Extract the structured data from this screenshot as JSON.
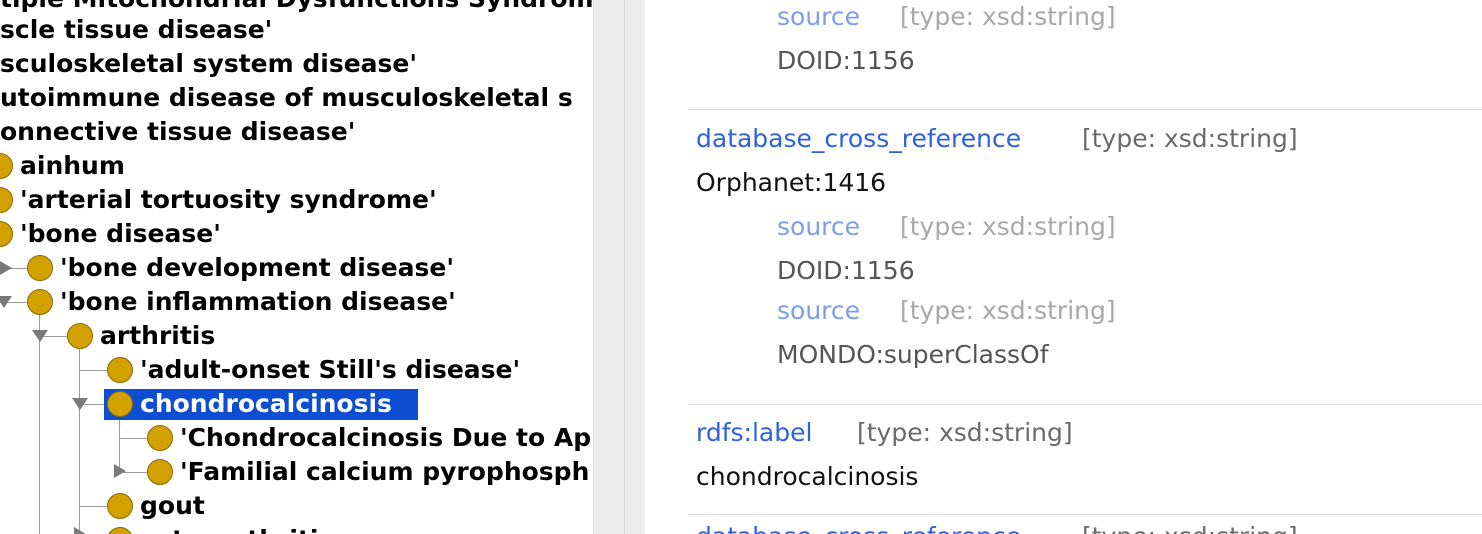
{
  "class_tree": {
    "nodes": [
      {
        "label": "tiple Mitochondrial Dysfunctions Syndrom"
      },
      {
        "label": "scle tissue disease'"
      },
      {
        "label": "sculoskeletal system disease'"
      },
      {
        "label": "utoimmune disease of musculoskeletal s"
      },
      {
        "label": "onnective tissue disease'"
      },
      {
        "label": "ainhum"
      },
      {
        "label": "'arterial tortuosity syndrome'"
      },
      {
        "label": "'bone disease'"
      },
      {
        "label": "'bone development disease'"
      },
      {
        "label": "'bone inflammation disease'"
      },
      {
        "label": "arthritis"
      },
      {
        "label": "'adult-onset Still's disease'"
      },
      {
        "label": "chondrocalcinosis",
        "selected": true
      },
      {
        "label": "'Chondrocalcinosis Due to Ap"
      },
      {
        "label": "'Familial calcium pyrophosph"
      },
      {
        "label": "gout"
      },
      {
        "label": "osteoarthritis"
      }
    ]
  },
  "annotations": {
    "top_source": {
      "prop": "source",
      "type": "[type: xsd:string]",
      "value": "DOID:1156"
    },
    "db_xref": {
      "prop": "database_cross_reference",
      "type": "[type: xsd:string]",
      "value": "Orphanet:1416",
      "sources": [
        {
          "prop": "source",
          "type": "[type: xsd:string]",
          "value": "DOID:1156"
        },
        {
          "prop": "source",
          "type": "[type: xsd:string]",
          "value": "MONDO:superClassOf"
        }
      ]
    },
    "label": {
      "prop": "rdfs:label",
      "type": "[type: xsd:string]",
      "value": "chondrocalcinosis"
    },
    "next": {
      "prop": "database_cross_reference",
      "type": "[type: xsd:string]"
    }
  },
  "colors": {
    "bullet": "#d2a100",
    "selection": "#0c4dd1",
    "property_link": "#2f62d9"
  }
}
